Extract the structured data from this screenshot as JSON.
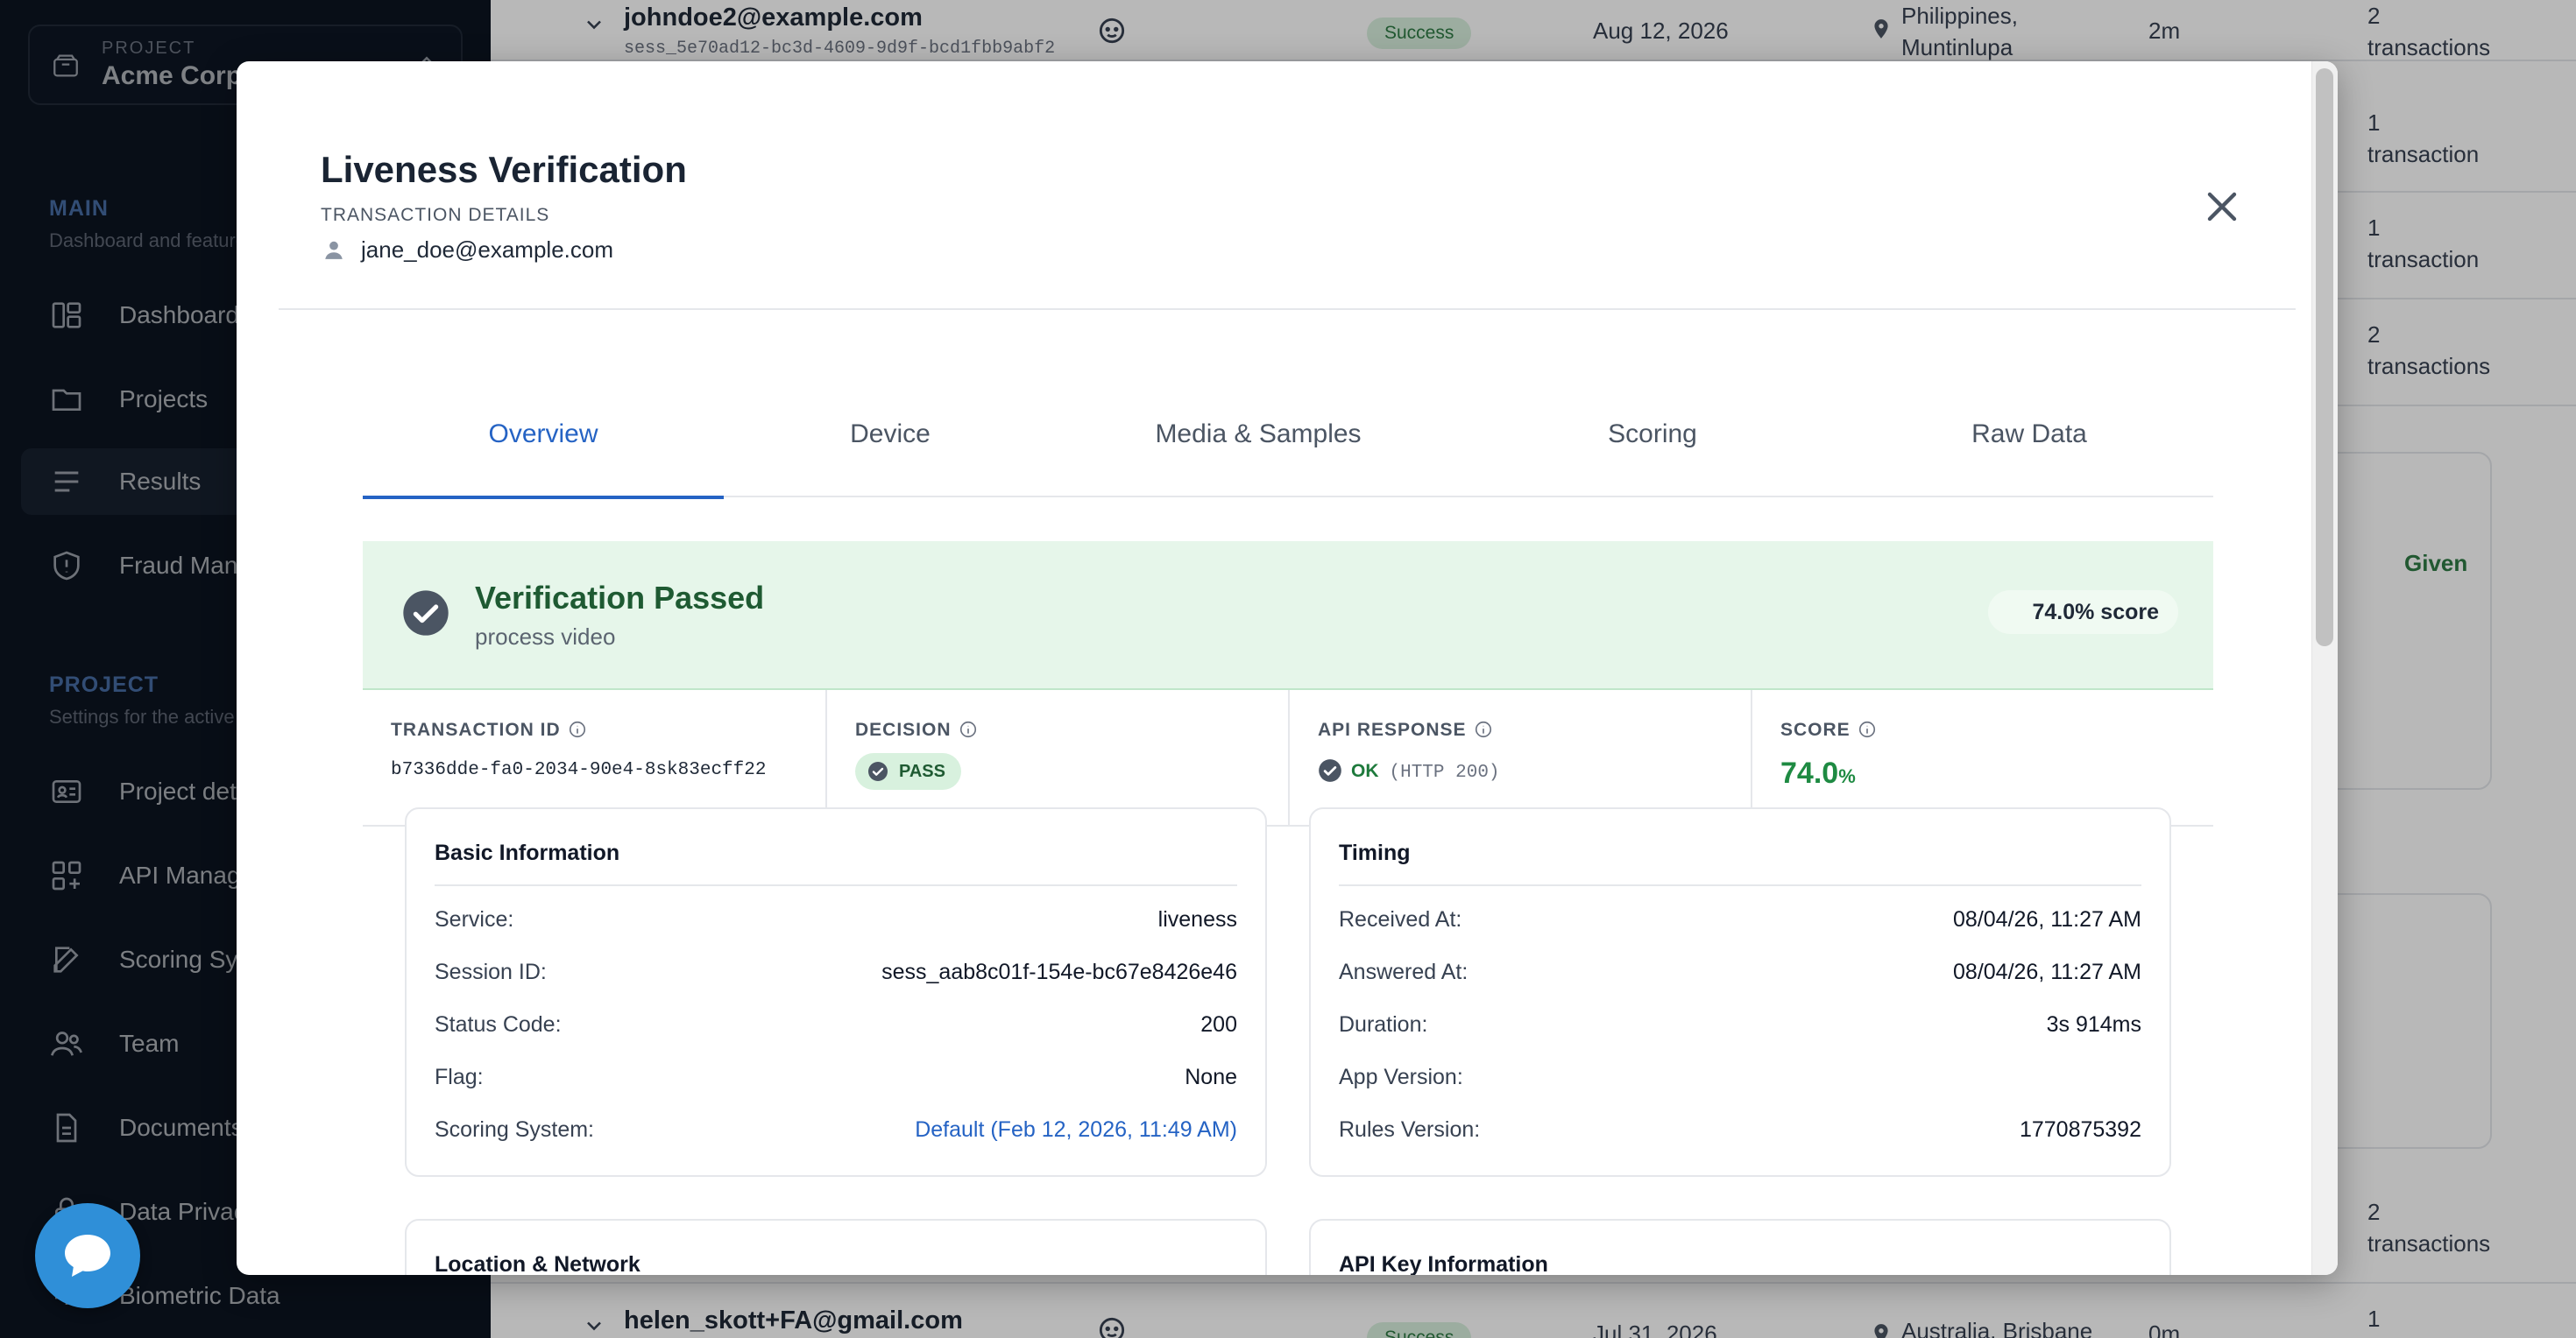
{
  "sidebar": {
    "project_label": "PROJECT",
    "project_name": "Acme Corp",
    "main_title": "MAIN",
    "main_sub": "Dashboard and features",
    "main_items": [
      {
        "label": "Dashboard",
        "icon": "dashboard-icon"
      },
      {
        "label": "Projects",
        "icon": "folder-icon"
      },
      {
        "label": "Results",
        "icon": "results-list-icon",
        "active": true
      },
      {
        "label": "Fraud Management",
        "icon": "shield-icon"
      }
    ],
    "project_title": "PROJECT",
    "project_sub": "Settings for the active project",
    "project_items": [
      {
        "label": "Project details",
        "icon": "id-card-icon"
      },
      {
        "label": "API Management",
        "icon": "api-grid-icon"
      },
      {
        "label": "Scoring System",
        "icon": "pencil-edit-icon"
      },
      {
        "label": "Team",
        "icon": "users-icon"
      },
      {
        "label": "Documents",
        "icon": "document-icon"
      },
      {
        "label": "Data Privacy",
        "icon": "privacy-icon"
      },
      {
        "label": "Biometric Data",
        "icon": "biometric-icon"
      }
    ]
  },
  "table": {
    "rows": [
      {
        "email": "johndoe2@example.com",
        "session": "sess_5e70ad12-bc3d-4609-9d9f-bcd1fbb9abf2",
        "status": "Success",
        "date": "Aug 12, 2026",
        "location": [
          "Philippines,",
          "Muntinlupa"
        ],
        "duration": "2m",
        "transactions": [
          "2",
          "transactions"
        ]
      },
      {
        "transactions": [
          "1",
          "transaction"
        ]
      },
      {
        "transactions": [
          "1",
          "transaction"
        ]
      },
      {
        "transactions": [
          "2",
          "transactions"
        ]
      },
      {
        "transactions": [
          "2",
          "transactions"
        ]
      },
      {
        "email": "helen_skott+FA@gmail.com",
        "status": "Success",
        "date": "Jul 31, 2026",
        "location": [
          "Australia, Brisbane"
        ],
        "duration": "0m",
        "transactions": [
          "1"
        ]
      }
    ],
    "given_label": "Given"
  },
  "modal": {
    "title": "Liveness Verification",
    "subtitle": "TRANSACTION DETAILS",
    "user_email": "jane_doe@example.com",
    "tabs": [
      "Overview",
      "Device",
      "Media & Samples",
      "Scoring",
      "Raw Data"
    ],
    "active_tab": "Overview",
    "banner": {
      "heading": "Verification Passed",
      "sub": "process video",
      "score_pill": "74.0% score",
      "color": "#e6f6ea"
    },
    "stats": {
      "transaction_id_label": "TRANSACTION ID",
      "transaction_id": "b7336dde-fa0-2034-90e4-8sk83ecff22",
      "decision_label": "DECISION",
      "decision": "PASS",
      "api_label": "API RESPONSE",
      "api_status": "OK",
      "api_code": "(HTTP 200)",
      "score_label": "SCORE",
      "score": "74.0",
      "score_unit": "%"
    },
    "basic": {
      "title": "Basic Information",
      "rows": [
        {
          "k": "Service:",
          "v": "liveness"
        },
        {
          "k": "Session ID:",
          "v": "sess_aab8c01f-154e-bc67e8426e46"
        },
        {
          "k": "Status Code:",
          "v": "200"
        },
        {
          "k": "Flag:",
          "v": "None"
        },
        {
          "k": "Scoring System:",
          "v": "Default (Feb 12, 2026, 11:49 AM)"
        }
      ]
    },
    "timing": {
      "title": "Timing",
      "rows": [
        {
          "k": "Received At:",
          "v": "08/04/26, 11:27 AM"
        },
        {
          "k": "Answered At:",
          "v": "08/04/26, 11:27 AM"
        },
        {
          "k": "Duration:",
          "v": "3s 914ms"
        },
        {
          "k": "App Version:",
          "v": ""
        },
        {
          "k": "Rules Version:",
          "v": "1770875392"
        }
      ]
    },
    "location_title": "Location & Network",
    "api_key_title": "API Key Information"
  },
  "colors": {
    "accent": "#2563c4",
    "success": "#1e8a42",
    "sidebar_bg": "#0f1a2a"
  }
}
